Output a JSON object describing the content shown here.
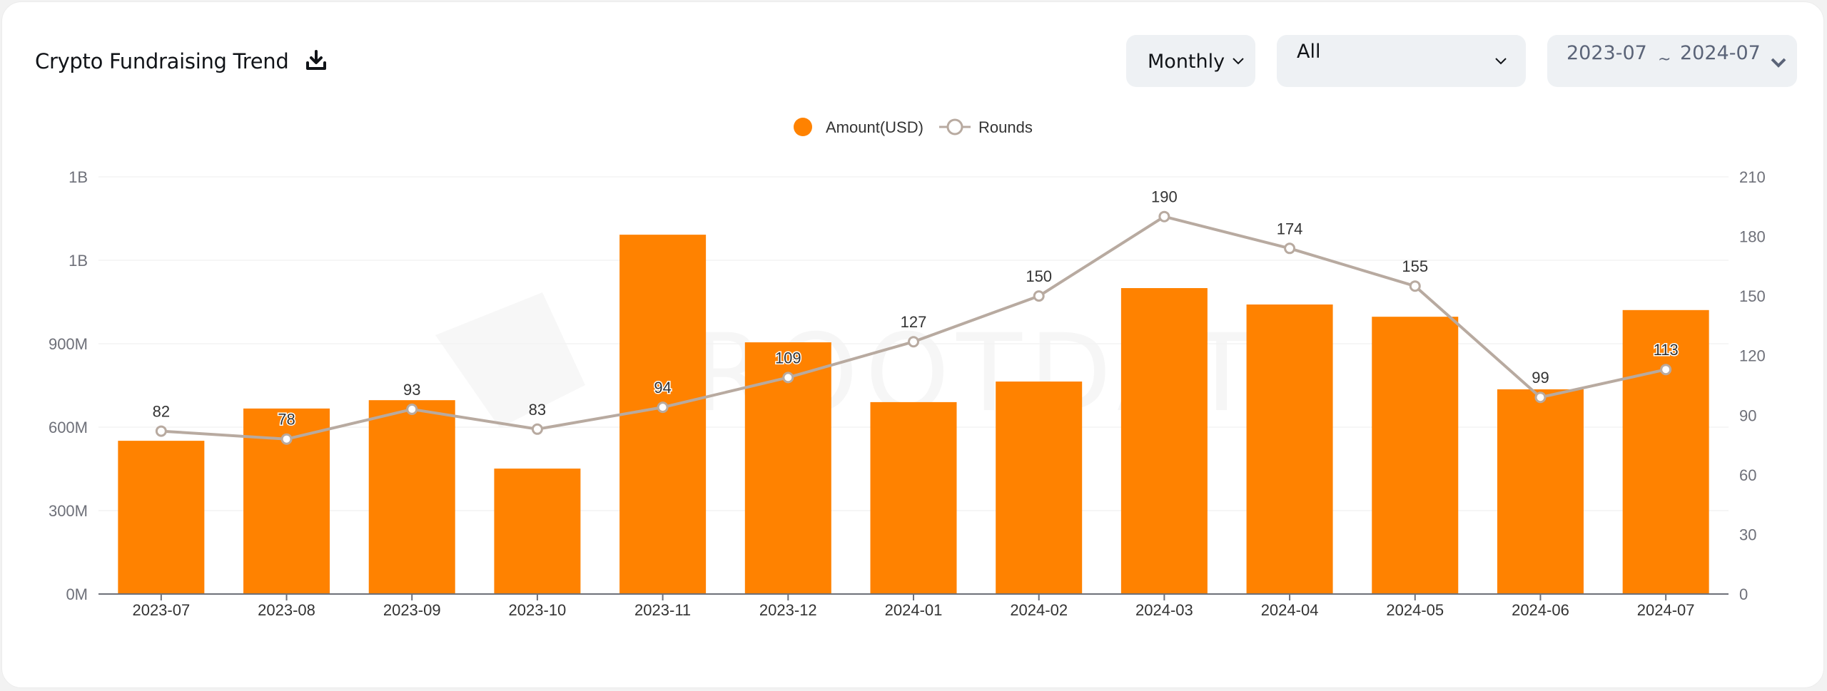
{
  "header": {
    "title": "Crypto Fundraising Trend",
    "download_icon": "download-icon"
  },
  "controls": {
    "granularity": {
      "value": "Monthly",
      "icon": "chevron-down-icon"
    },
    "category": {
      "value": "All",
      "icon": "chevron-down-icon"
    },
    "date_range": {
      "start": "2023-07",
      "separator": "~",
      "end": "2024-07",
      "icon": "chevron-down-icon"
    }
  },
  "watermark": "ROOTDATA",
  "colors": {
    "bar": "#ff8200",
    "line": "#b8aaa0",
    "point_fill": "#ffffff",
    "grid": "#f3f3f3",
    "axis": "#6e7079"
  },
  "chart_data": {
    "type": "bar+line",
    "title": "Crypto Fundraising Trend",
    "categories": [
      "2023-07",
      "2023-08",
      "2023-09",
      "2023-10",
      "2023-11",
      "2023-12",
      "2024-01",
      "2024-02",
      "2024-03",
      "2024-04",
      "2024-05",
      "2024-06",
      "2024-07"
    ],
    "series": [
      {
        "name": "Amount(USD)",
        "type": "bar",
        "axis": "left",
        "values": [
          551000000,
          667000000,
          697000000,
          451000000,
          1292000000,
          905000000,
          690000000,
          764000000,
          1100000000,
          1041000000,
          997000000,
          736000000,
          1021000000
        ]
      },
      {
        "name": "Rounds",
        "type": "line",
        "axis": "right",
        "values": [
          82,
          78,
          93,
          83,
          94,
          109,
          127,
          150,
          190,
          174,
          155,
          99,
          113
        ],
        "labels_shown": true
      }
    ],
    "y_left": {
      "ylim": [
        0,
        1500000000
      ],
      "ticks": [
        0,
        300000000,
        600000000,
        900000000,
        1200000000,
        1500000000
      ],
      "tick_labels": [
        "0M",
        "300M",
        "600M",
        "900M",
        "1B",
        "1B"
      ]
    },
    "y_right": {
      "ylim": [
        0,
        210
      ],
      "ticks": [
        0,
        30,
        60,
        90,
        120,
        150,
        180,
        210
      ],
      "tick_labels": [
        "0",
        "30",
        "60",
        "90",
        "120",
        "150",
        "180",
        "210"
      ]
    },
    "legend": {
      "position": "top-center",
      "items": [
        {
          "name": "Amount(USD)",
          "symbol": "circle"
        },
        {
          "name": "Rounds",
          "symbol": "line-empty-circle"
        }
      ]
    },
    "grid": true
  }
}
